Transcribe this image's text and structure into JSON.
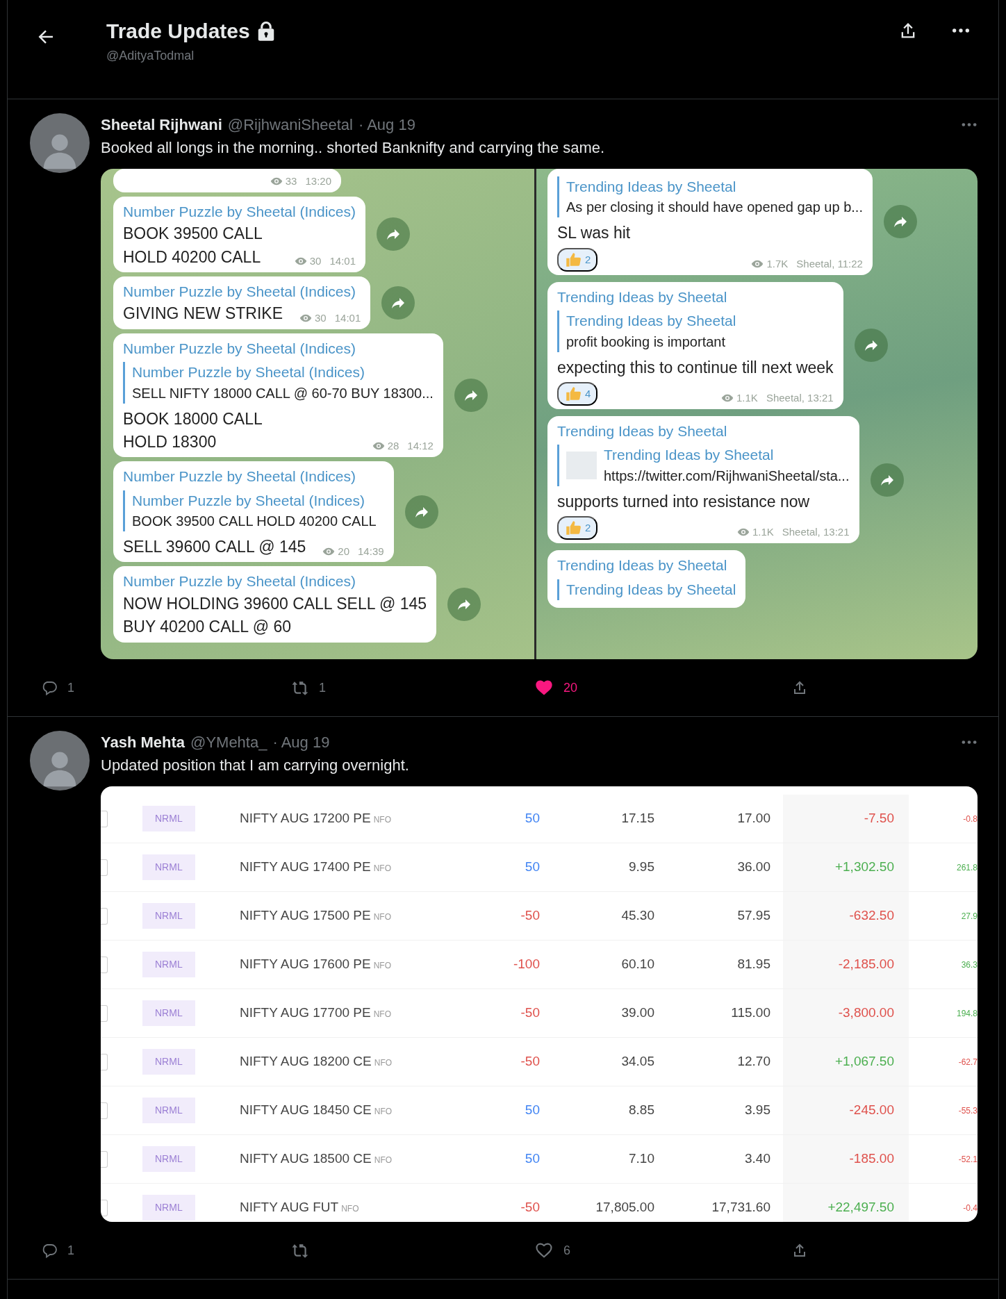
{
  "header": {
    "title": "Trade Updates",
    "handle": "@AdityaTodmal"
  },
  "tweets": [
    {
      "author": "Sheetal Rijhwani",
      "handle": "@RijhwaniSheetal",
      "date": "· Aug 19",
      "text": "Booked all longs in the morning.. shorted Banknifty and carrying the same.",
      "media": {
        "kind": "chat",
        "columns": [
          {
            "messages": [
              {
                "meta": {
                  "views": "33",
                  "sign": "13:20"
                }
              },
              {
                "channel": "Number Puzzle by Sheetal (Indices)",
                "lines": [
                  "BOOK 39500 CALL",
                  "HOLD 40200 CALL"
                ],
                "meta": {
                  "views": "30",
                  "sign": "14:01"
                }
              },
              {
                "channel": "Number Puzzle by Sheetal (Indices)",
                "lines": [
                  "GIVING NEW STRIKE"
                ],
                "meta": {
                  "views": "30",
                  "sign": "14:01"
                }
              },
              {
                "channel": "Number Puzzle by Sheetal (Indices)",
                "quote": {
                  "title": "Number Puzzle by Sheetal (Indices)",
                  "text": "SELL NIFTY 18000 CALL @ 60-70 BUY 18300..."
                },
                "lines": [
                  "BOOK 18000 CALL",
                  "HOLD 18300"
                ],
                "meta": {
                  "views": "28",
                  "sign": "14:12"
                }
              },
              {
                "channel": "Number Puzzle by Sheetal (Indices)",
                "quote": {
                  "title": "Number Puzzle by Sheetal (Indices)",
                  "text": "BOOK 39500 CALL HOLD 40200 CALL"
                },
                "lines": [
                  "SELL 39600 CALL @ 145"
                ],
                "meta": {
                  "views": "20",
                  "sign": "14:39"
                }
              },
              {
                "channel": "Number Puzzle by Sheetal (Indices)",
                "lines": [
                  "NOW HOLDING 39600 CALL SELL @ 145",
                  "BUY 40200 CALL @ 60"
                ]
              }
            ]
          },
          {
            "messages": [
              {
                "quote": {
                  "title": "Trending Ideas by Sheetal",
                  "text": "As per closing it should have opened gap up b..."
                },
                "lines": [
                  "SL was hit"
                ],
                "reaction": "2",
                "meta": {
                  "views": "1.7K",
                  "sign": "Sheetal, 11:22"
                }
              },
              {
                "channel": "Trending Ideas by Sheetal",
                "quote": {
                  "title": "Trending Ideas by Sheetal",
                  "text": "profit booking is important"
                },
                "lines": [
                  "expecting this to continue till next week"
                ],
                "reaction": "4",
                "meta": {
                  "views": "1.1K",
                  "sign": "Sheetal, 13:21"
                }
              },
              {
                "channel": "Trending Ideas by Sheetal",
                "quote": {
                  "title": "Trending Ideas by Sheetal",
                  "text": "https://twitter.com/RijhwaniSheetal/sta...",
                  "thumbnail": true
                },
                "lines": [
                  "supports turned into resistance now"
                ],
                "reaction": "2",
                "meta": {
                  "views": "1.1K",
                  "sign": "Sheetal, 13:21"
                }
              },
              {
                "channel": "Trending Ideas by Sheetal",
                "quote": {
                  "title": "Trending Ideas by Sheetal"
                }
              }
            ]
          }
        ]
      },
      "actions": {
        "replies": "1",
        "retweets": "1",
        "likes": "20",
        "liked": true
      }
    },
    {
      "author": "Yash Mehta",
      "handle": "@YMehta_",
      "date": "· Aug 19",
      "text": "Updated position that I am carrying overnight.",
      "media": {
        "kind": "positions",
        "rows": [
          {
            "checked": false,
            "product": "NRML",
            "instrument": "NIFTY AUG 17200 PE",
            "exchange": "NFO",
            "qty": {
              "text": "50",
              "color": "#4184f3"
            },
            "avg": "17.15",
            "ltp": "17.00",
            "pnl": {
              "text": "-7.50",
              "color": "#df514c"
            },
            "chg": {
              "text": "-0.8",
              "color": "#df514c"
            }
          },
          {
            "checked": false,
            "product": "NRML",
            "instrument": "NIFTY AUG 17400 PE",
            "exchange": "NFO",
            "qty": {
              "text": "50",
              "color": "#4184f3"
            },
            "avg": "9.95",
            "ltp": "36.00",
            "pnl": {
              "text": "+1,302.50",
              "color": "#4caf50"
            },
            "chg": {
              "text": "261.8",
              "color": "#4caf50"
            }
          },
          {
            "checked": false,
            "product": "NRML",
            "instrument": "NIFTY AUG 17500 PE",
            "exchange": "NFO",
            "qty": {
              "text": "-50",
              "color": "#df514c"
            },
            "avg": "45.30",
            "ltp": "57.95",
            "pnl": {
              "text": "-632.50",
              "color": "#df514c"
            },
            "chg": {
              "text": "27.9",
              "color": "#4caf50"
            }
          },
          {
            "checked": false,
            "product": "NRML",
            "instrument": "NIFTY AUG 17600 PE",
            "exchange": "NFO",
            "qty": {
              "text": "-100",
              "color": "#df514c"
            },
            "avg": "60.10",
            "ltp": "81.95",
            "pnl": {
              "text": "-2,185.00",
              "color": "#df514c"
            },
            "chg": {
              "text": "36.3",
              "color": "#4caf50"
            }
          },
          {
            "checked": false,
            "product": "NRML",
            "instrument": "NIFTY AUG 17700 PE",
            "exchange": "NFO",
            "qty": {
              "text": "-50",
              "color": "#df514c"
            },
            "avg": "39.00",
            "ltp": "115.00",
            "pnl": {
              "text": "-3,800.00",
              "color": "#df514c"
            },
            "chg": {
              "text": "194.8",
              "color": "#4caf50"
            }
          },
          {
            "checked": false,
            "product": "NRML",
            "instrument": "NIFTY AUG 18200 CE",
            "exchange": "NFO",
            "qty": {
              "text": "-50",
              "color": "#df514c"
            },
            "avg": "34.05",
            "ltp": "12.70",
            "pnl": {
              "text": "+1,067.50",
              "color": "#4caf50"
            },
            "chg": {
              "text": "-62.7",
              "color": "#df514c"
            }
          },
          {
            "checked": false,
            "product": "NRML",
            "instrument": "NIFTY AUG 18450 CE",
            "exchange": "NFO",
            "qty": {
              "text": "50",
              "color": "#4184f3"
            },
            "avg": "8.85",
            "ltp": "3.95",
            "pnl": {
              "text": "-245.00",
              "color": "#df514c"
            },
            "chg": {
              "text": "-55.3",
              "color": "#df514c"
            }
          },
          {
            "checked": false,
            "product": "NRML",
            "instrument": "NIFTY AUG 18500 CE",
            "exchange": "NFO",
            "qty": {
              "text": "50",
              "color": "#4184f3"
            },
            "avg": "7.10",
            "ltp": "3.40",
            "pnl": {
              "text": "-185.00",
              "color": "#df514c"
            },
            "chg": {
              "text": "-52.1",
              "color": "#df514c"
            }
          },
          {
            "checked": false,
            "product": "NRML",
            "instrument": "NIFTY AUG FUT",
            "exchange": "NFO",
            "qty": {
              "text": "-50",
              "color": "#df514c"
            },
            "avg": "17,805.00",
            "ltp": "17,731.60",
            "pnl": {
              "text": "+22,497.50",
              "color": "#4caf50"
            },
            "chg": {
              "text": "-0.4",
              "color": "#df514c"
            }
          }
        ]
      },
      "actions": {
        "replies": "1",
        "likes": "6",
        "liked": false
      }
    }
  ]
}
